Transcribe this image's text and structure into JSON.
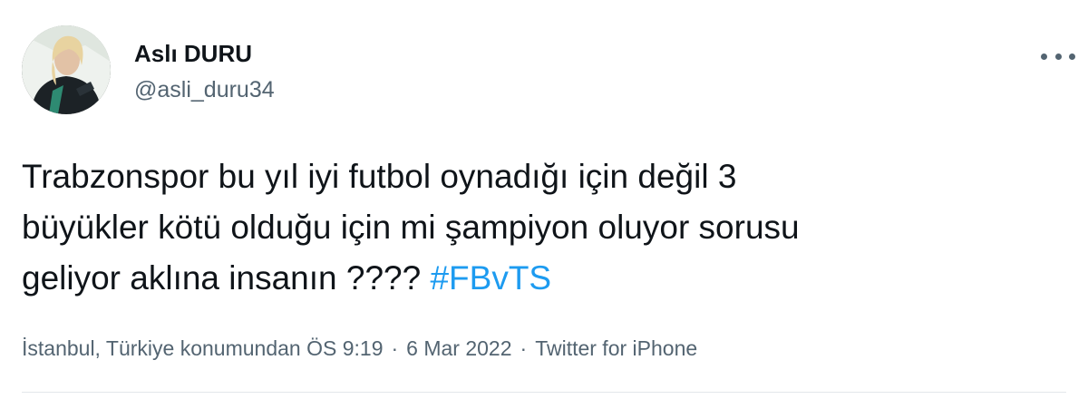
{
  "user": {
    "display_name": "Aslı DURU",
    "handle": "@asli_duru34"
  },
  "tweet": {
    "line1": "Trabzonspor bu yıl iyi futbol oynadığı için değil 3",
    "line2": "büyükler kötü olduğu için mi şampiyon oluyor sorusu",
    "line3_text": "geliyor aklına insanın ???? ",
    "hashtag": "#FBvTS"
  },
  "meta": {
    "location_time": "İstanbul, Türkiye konumundan ÖS 9:19",
    "separator": "·",
    "date": "6 Mar 2022",
    "source": "Twitter for iPhone"
  },
  "icons": {
    "avatar": "profile-photo",
    "more": "more-options-icon"
  },
  "colors": {
    "text": "#0f1419",
    "secondary": "#536471",
    "link": "#1d9bf0"
  }
}
